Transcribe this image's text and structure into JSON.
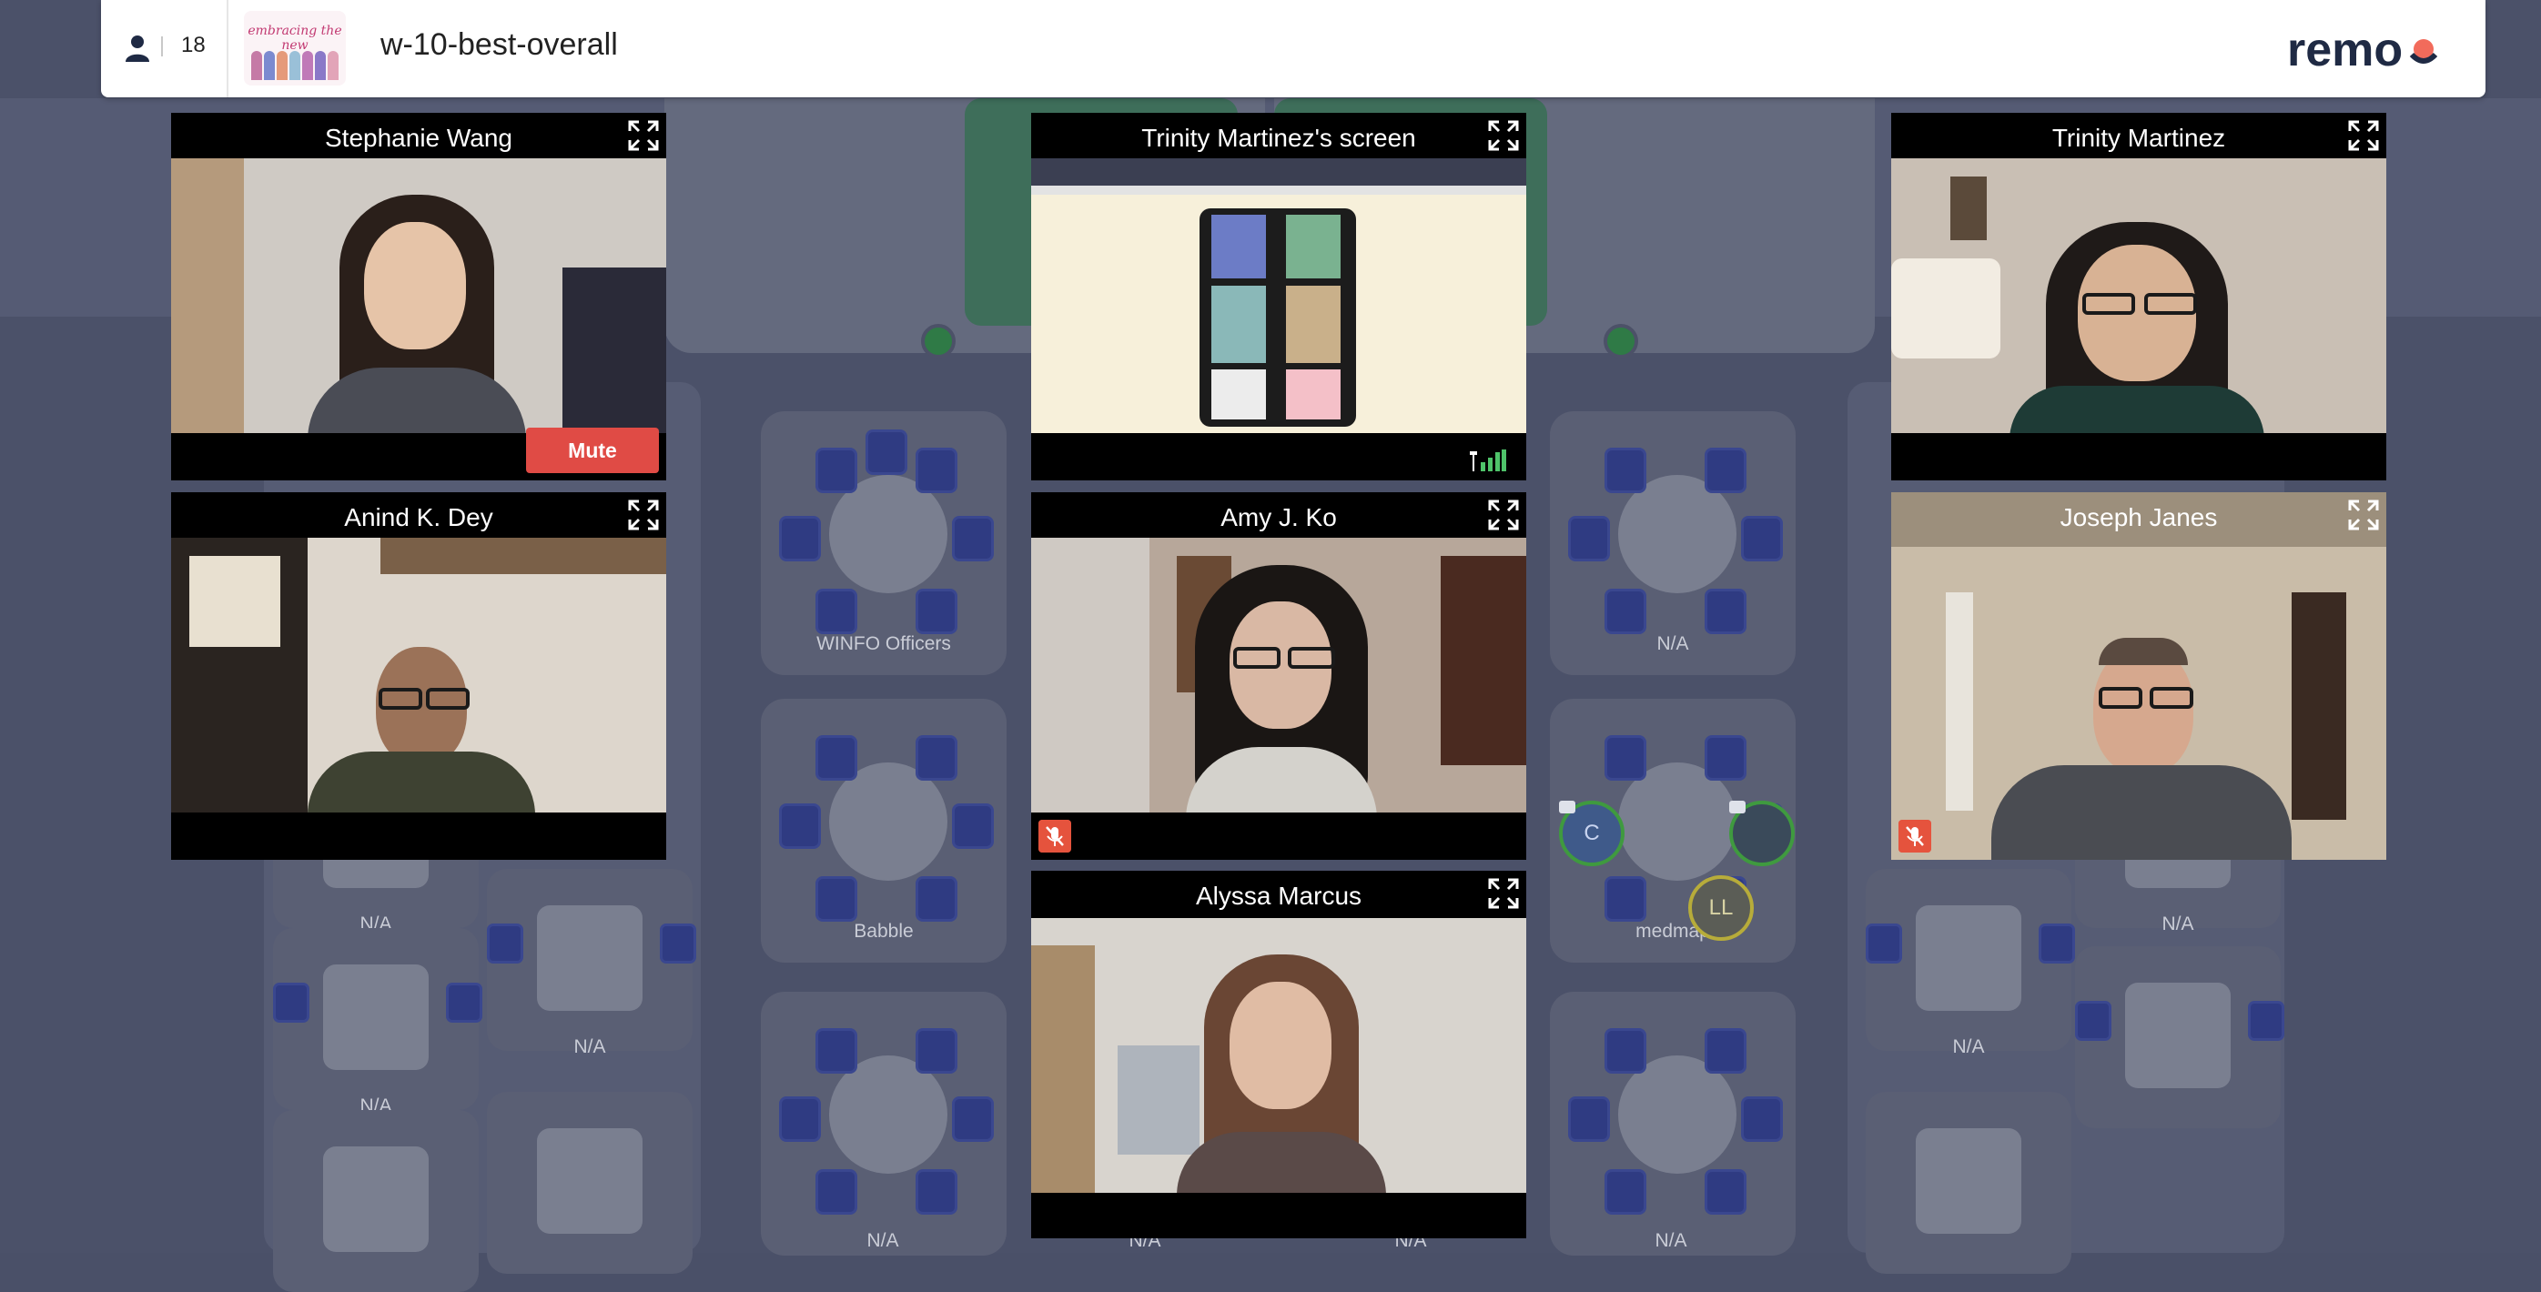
{
  "header": {
    "participant_count": "18",
    "room_name": "w-10-best-overall",
    "event_logo_text": "embracing the new",
    "brand": "remo"
  },
  "tiles": {
    "stephanie": {
      "name": "Stephanie Wang",
      "mute_label": "Mute"
    },
    "screen": {
      "name": "Trinity Martinez's screen"
    },
    "trinity": {
      "name": "Trinity Martinez"
    },
    "anind": {
      "name": "Anind K. Dey"
    },
    "amy": {
      "name": "Amy J. Ko"
    },
    "joseph": {
      "name": "Joseph Janes"
    },
    "alyssa": {
      "name": "Alyssa Marcus"
    }
  },
  "floor": {
    "tables": {
      "winfo": "WINFO Officers",
      "babble": "Babble",
      "medmap": "medmap",
      "na": "N/A"
    },
    "bubbles": {
      "c": "C",
      "ll": "LL"
    }
  },
  "colors": {
    "accent_red": "#e04b45",
    "floor": "#4b5169",
    "chair": "#2f3b82",
    "remo_orange": "#f26b5b"
  }
}
